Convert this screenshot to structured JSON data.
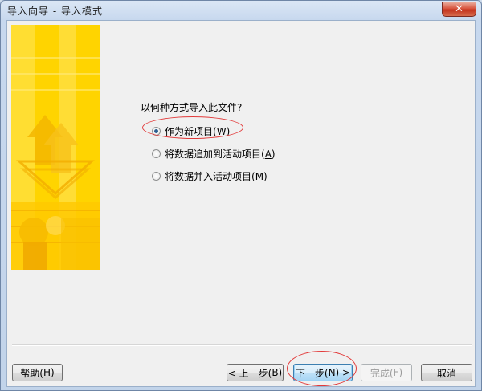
{
  "window": {
    "title": "导入向导 - 导入模式",
    "close_label": "✕"
  },
  "wizard": {
    "question": "以何种方式导入此文件?",
    "options": [
      {
        "text": "作为新项目(",
        "mnemonic": "W",
        "suffix": ")",
        "selected": true
      },
      {
        "text": "将数据追加到活动项目(",
        "mnemonic": "A",
        "suffix": ")",
        "selected": false
      },
      {
        "text": "将数据并入活动项目(",
        "mnemonic": "M",
        "suffix": ")",
        "selected": false
      }
    ]
  },
  "buttons": {
    "help": {
      "text": "帮助(",
      "mnemonic": "H",
      "suffix": ")"
    },
    "back": {
      "text": "< 上一步(",
      "mnemonic": "B",
      "suffix": ")"
    },
    "next": {
      "text": "下一步(",
      "mnemonic": "N",
      "suffix": ") >"
    },
    "finish": {
      "text": "完成(",
      "mnemonic": "F",
      "suffix": ")"
    },
    "cancel": {
      "text": "取消"
    }
  },
  "colors": {
    "accent": "#ffcc00",
    "annotation": "#e23a3a",
    "default_button": "#bfe1f7"
  }
}
